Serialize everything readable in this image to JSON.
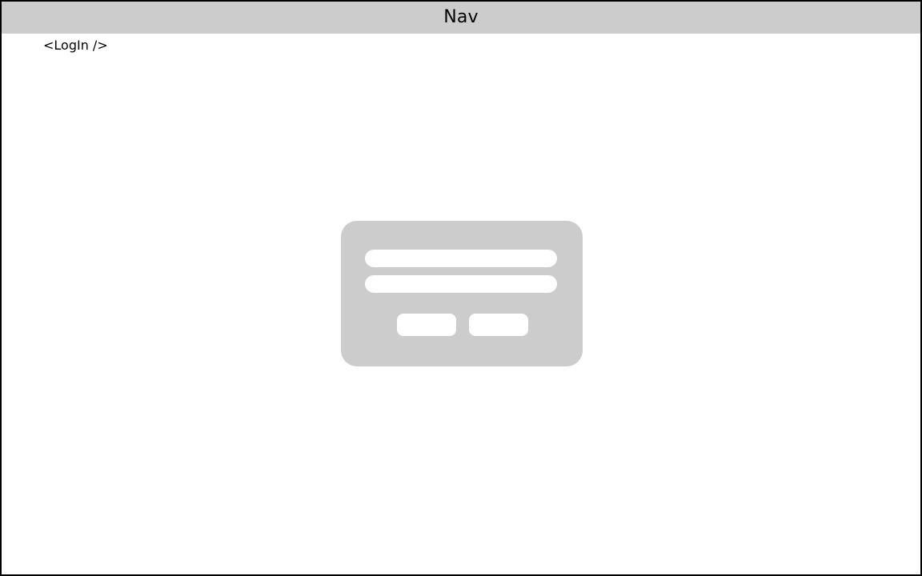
{
  "nav": {
    "title": "Nav"
  },
  "main": {
    "component_label": "<LogIn />"
  },
  "login_form": {
    "username_value": "",
    "password_value": "",
    "primary_button_label": "",
    "secondary_button_label": ""
  },
  "colors": {
    "nav_background": "#cccccc",
    "card_background": "#cccccc",
    "field_background": "#ffffff",
    "border": "#000000"
  }
}
